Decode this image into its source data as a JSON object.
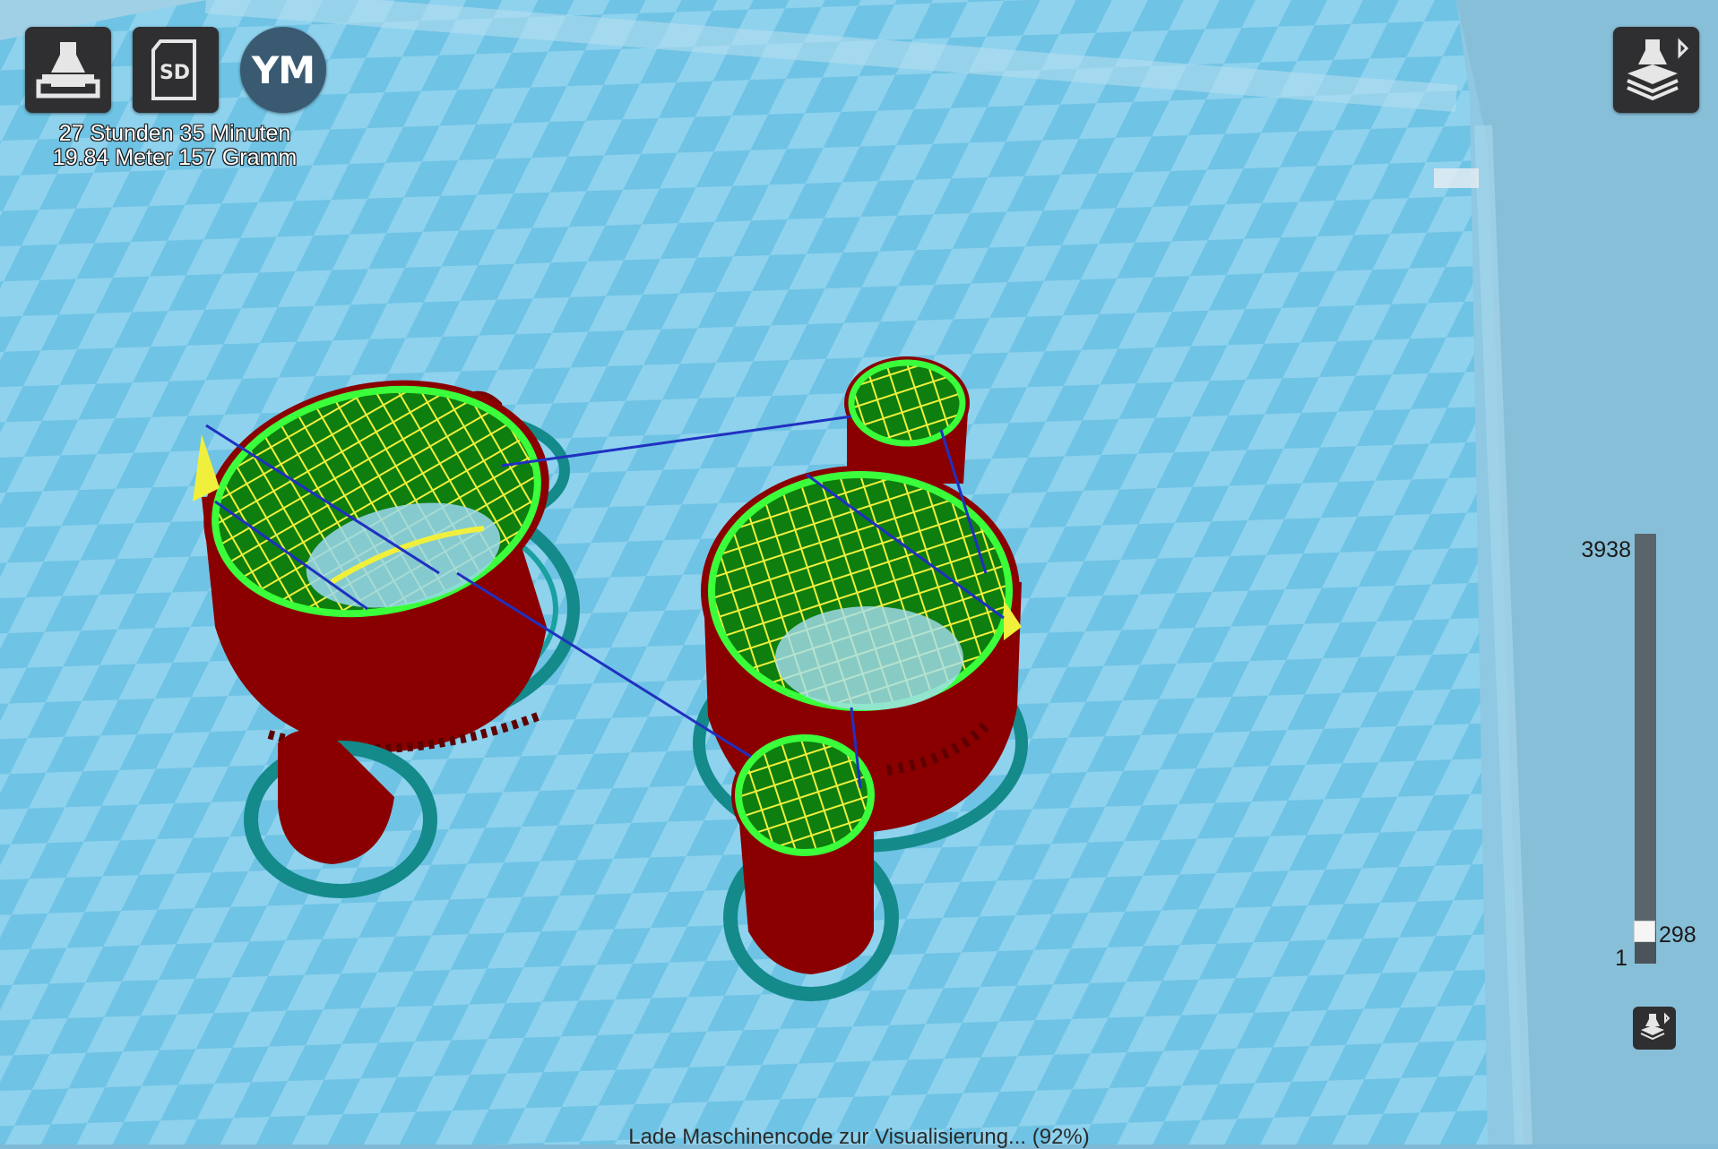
{
  "toolbar": {
    "print_icon": "printer-icon",
    "sd_label": "SD",
    "avatar_initials": "YM"
  },
  "estimate": {
    "time": "27 Stunden 35 Minuten",
    "material": "19.84 Meter 157 Gramm"
  },
  "layer_view": {
    "icon": "layer-view-icon"
  },
  "layer_slider": {
    "max": "3938",
    "current": "298",
    "min": "1",
    "current_fraction": 0.0755
  },
  "status": {
    "text": "Lade Maschinencode zur Visualisierung... (92%)"
  },
  "colors": {
    "bed": "#7fb9d6",
    "wall": "#8a0000",
    "infill": "#f0f03c",
    "skin": "#2ecc2e",
    "travel": "#2030c0",
    "brim": "#148a8a"
  }
}
